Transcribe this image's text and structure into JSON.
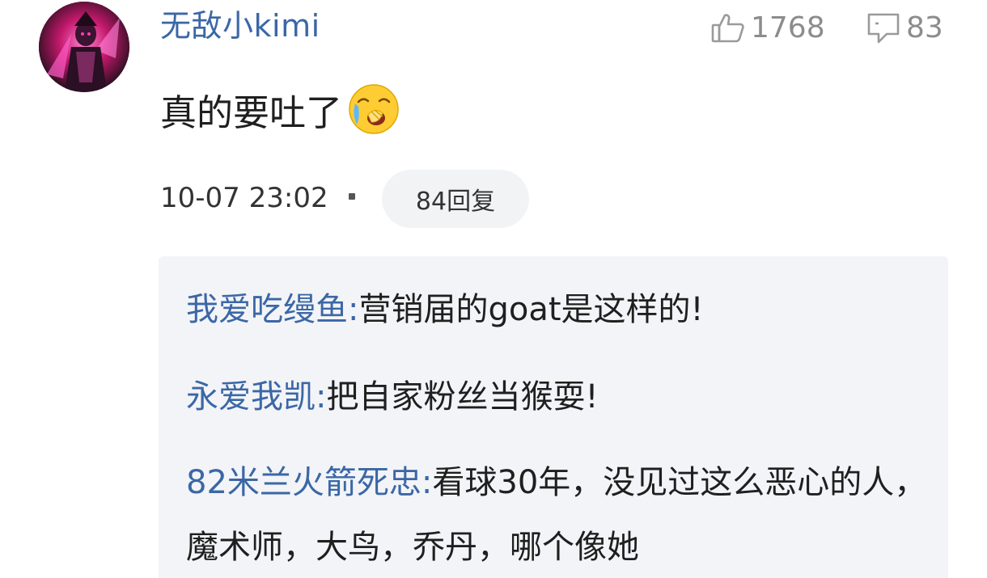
{
  "comment": {
    "avatar_icon": "anime-character-avatar",
    "username": "无敌小kimi",
    "likes": "1768",
    "comments": "83",
    "text": "真的要吐了",
    "emoji": "vomit-crying-emoji",
    "timestamp": "10-07 23:02",
    "reply_count_label": "84回复"
  },
  "replies": [
    {
      "author": "我爱吃缦鱼:",
      "text": "营销届的goat是这样的!"
    },
    {
      "author": "永爱我凯:",
      "text": "把自家粉丝当猴耍!"
    },
    {
      "author": "82米兰火箭死忠:",
      "text": "看球30年，没见过这么恶心的人，魔术师，大鸟，乔丹，哪个像她"
    }
  ],
  "colors": {
    "username": "#3b67a6",
    "reply_author": "#3b67a6",
    "replies_bg": "#f3f4f7",
    "pill_bg": "#f2f3f5"
  }
}
